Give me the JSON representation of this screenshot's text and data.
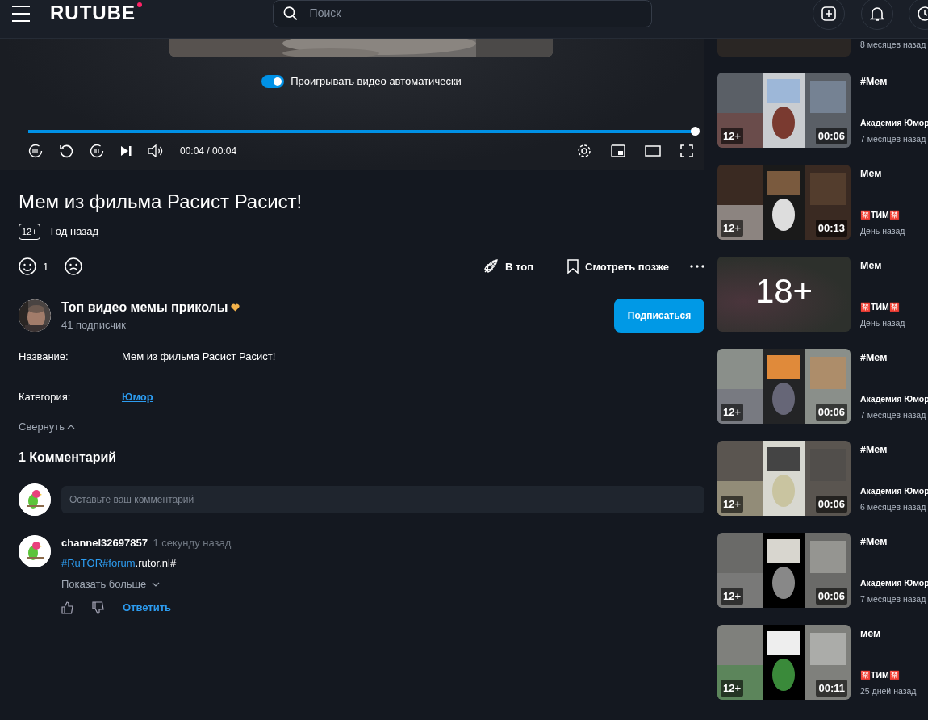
{
  "header": {
    "logo": "RUTUBE",
    "search_placeholder": "Поиск"
  },
  "player": {
    "autoplay": {
      "label": "Проигрывать видео автоматически",
      "on": true
    },
    "progress": {
      "level": 1
    },
    "time": "00:04 / 00:04"
  },
  "video": {
    "title": "Мем из фильма Расист Расист!",
    "age": "12+",
    "date": "Год назад",
    "likes": "1",
    "actions": [
      {
        "kind": "top",
        "label": "В топ"
      },
      {
        "kind": "later",
        "label": "Смотреть позже"
      }
    ]
  },
  "channel": {
    "name": "Топ видео мемы приколы",
    "subscribers": "41 подписчик",
    "subscribe": "Подписаться"
  },
  "details": [
    {
      "kind": "text",
      "label": "Название:",
      "value": "Мем из фильма Расист Расист!"
    },
    {
      "kind": "link",
      "label": "Категория:",
      "value": "Юмор"
    }
  ],
  "collapse": "Свернуть",
  "comments": {
    "heading": "1 Комментарий",
    "placeholder": "Оставьте ваш комментарий",
    "items": [
      {
        "author": "channel32697857",
        "time": "1 секунду назад",
        "parts": [
          {
            "kind": "hashtag",
            "text": "#RuTOR"
          },
          {
            "kind": "hashtag",
            "text": "#forum"
          },
          {
            "kind": "plain",
            "text": ".rutor.nl#"
          }
        ],
        "more": "Показать больше",
        "reply": "Ответить"
      }
    ]
  },
  "sidebar": [
    {
      "kind": "partial",
      "date": "8 месяцев назад"
    },
    {
      "kind": "video",
      "title": "#Мем",
      "channel": "Академия Юмор",
      "date": "7 месяцев назад",
      "age": "12+",
      "duration": "00:06"
    },
    {
      "kind": "video",
      "title": "Мем",
      "channel": "🈲ТИМ🈲",
      "date": "День назад",
      "age": "12+",
      "duration": "00:13"
    },
    {
      "kind": "adult",
      "title": "Мем",
      "channel": "🈲ТИМ🈲",
      "date": "День назад",
      "cover": "18+"
    },
    {
      "kind": "video",
      "title": "#Мем",
      "channel": "Академия Юмор",
      "date": "7 месяцев назад",
      "age": "12+",
      "duration": "00:06"
    },
    {
      "kind": "video",
      "title": "#Мем",
      "channel": "Академия Юмор",
      "date": "6 месяцев назад",
      "age": "12+",
      "duration": "00:06"
    },
    {
      "kind": "video",
      "title": "#Мем",
      "channel": "Академия Юмор",
      "date": "7 месяцев назад",
      "age": "12+",
      "duration": "00:06"
    },
    {
      "kind": "video",
      "title": "мем",
      "channel": "🈲ТИМ🈲",
      "date": "25 дней назад",
      "age": "12+",
      "duration": "00:11"
    }
  ]
}
